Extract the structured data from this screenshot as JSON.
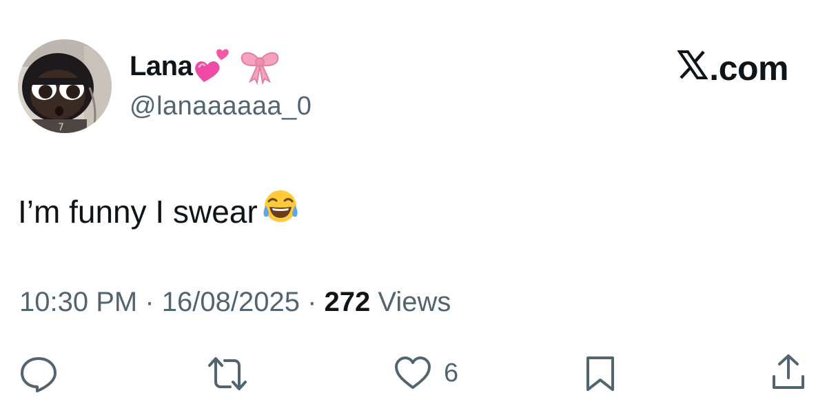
{
  "author": {
    "display_name": "Lana",
    "handle": "@lanaaaaaa_0",
    "name_emojis": [
      "two-hearts",
      "ribbon"
    ]
  },
  "brand": {
    "label": ".com",
    "logo": "x-logo-icon"
  },
  "tweet": {
    "text": "I’m funny I swear",
    "trailing_emoji": "face-with-tears-of-joy"
  },
  "meta": {
    "time": "10:30 PM",
    "separator": " · ",
    "date": "16/08/2025",
    "views_count": "272",
    "views_label": " Views"
  },
  "actions": {
    "reply": {
      "icon": "reply-icon"
    },
    "repost": {
      "icon": "repost-icon"
    },
    "like": {
      "icon": "heart-icon",
      "count": "6"
    },
    "bookmark": {
      "icon": "bookmark-icon"
    },
    "share": {
      "icon": "share-icon"
    }
  },
  "colors": {
    "text_primary": "#0f1419",
    "text_secondary": "#536471",
    "background": "#ffffff"
  }
}
